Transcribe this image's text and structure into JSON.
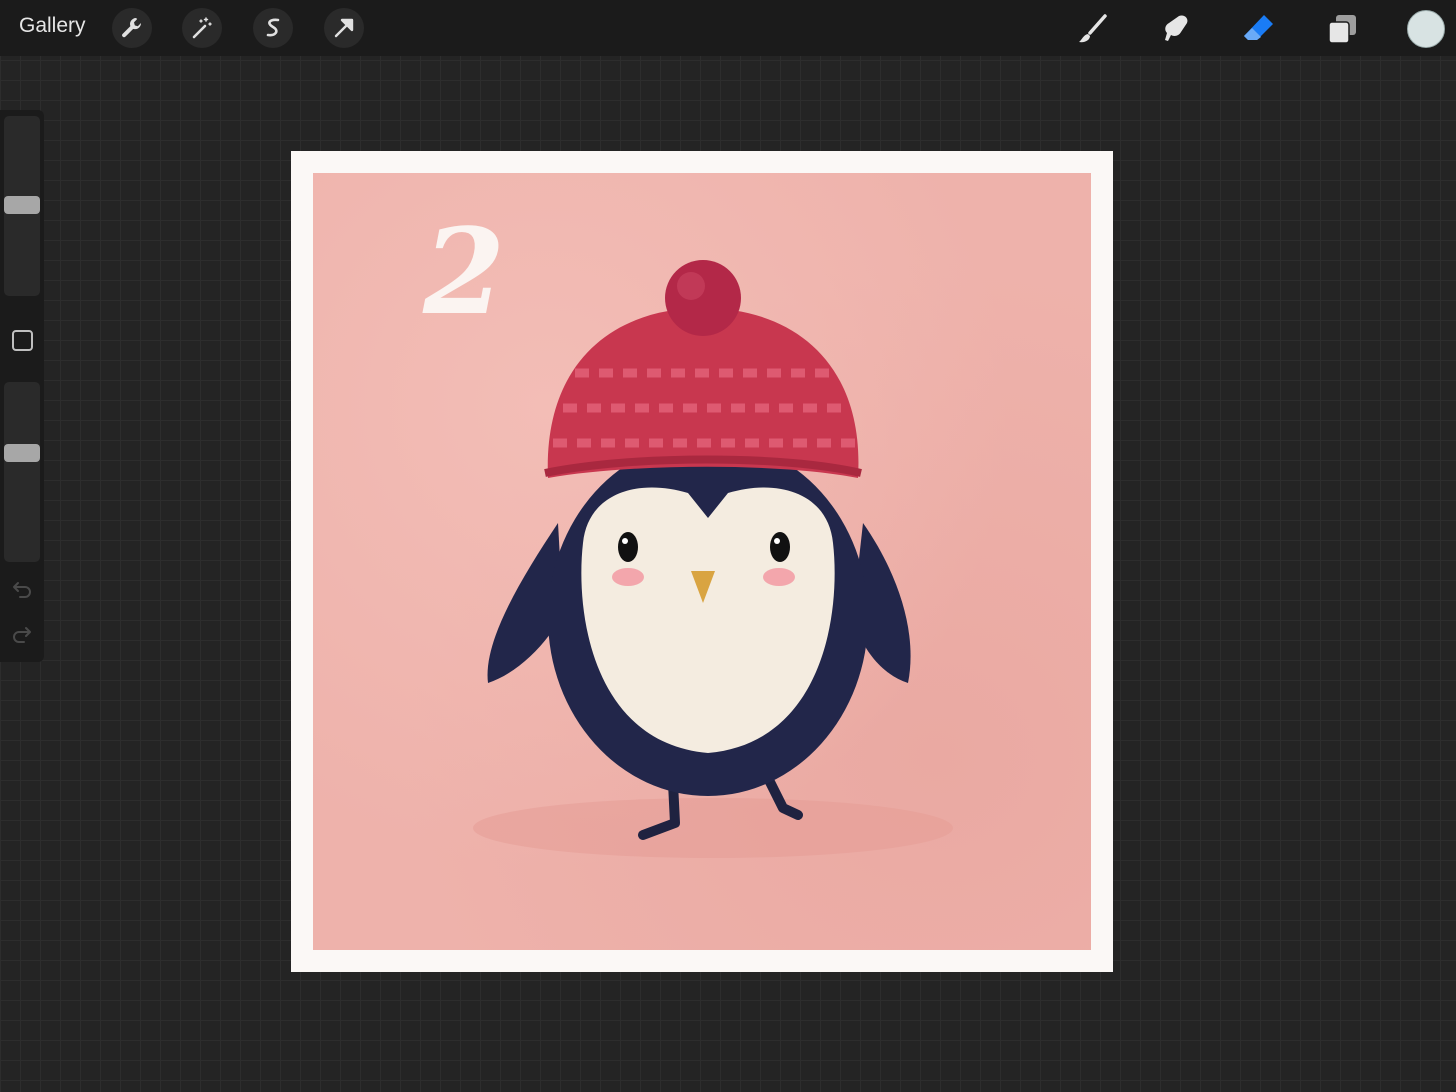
{
  "toolbar": {
    "gallery_label": "Gallery",
    "left_tools": [
      "wrench-icon",
      "magic-wand-icon",
      "selection-icon",
      "transform-arrow-icon"
    ],
    "right_tools": [
      "brush-icon",
      "smudge-icon",
      "eraser-icon",
      "layers-icon"
    ],
    "active_tool": "eraser",
    "active_color": "#d8e3e3",
    "accent_color": "#1a7cf5"
  },
  "sidebar": {
    "brush_size_level": 0.5,
    "opacity_level": 0.4,
    "controls": [
      "brush-size-slider",
      "modify-button",
      "opacity-slider",
      "undo-icon",
      "redo-icon"
    ]
  },
  "canvas": {
    "number_label": "2",
    "background_color": "#eeb2ab",
    "frame_color": "#fbf8f6"
  }
}
